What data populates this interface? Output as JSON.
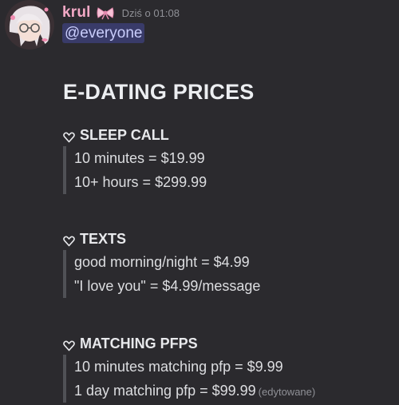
{
  "message": {
    "author": "krul",
    "author_color": "#f3a9c6",
    "timestamp": "Dziś o 01:08",
    "mention": "@everyone",
    "title": "E-DATING PRICES",
    "edited_label": "(edytowane)",
    "sections": [
      {
        "heading": "SLEEP CALL",
        "lines": [
          "10 minutes = $19.99",
          "10+ hours = $299.99"
        ]
      },
      {
        "heading": "TEXTS",
        "lines": [
          "good morning/night = $4.99",
          "\"I love you\" =  $4.99/message"
        ]
      },
      {
        "heading": "MATCHING PFPS",
        "lines": [
          "10 minutes matching pfp = $9.99",
          "1 day matching pfp = $99.99"
        ]
      }
    ]
  },
  "icons": {
    "avatar": "anime-avatar",
    "bow": "ribbon-bow-icon",
    "heart": "heart-outline-icon"
  }
}
